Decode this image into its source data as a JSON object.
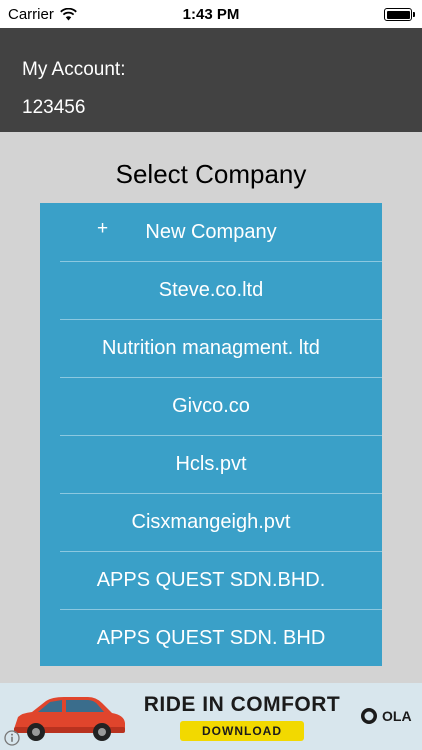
{
  "status_bar": {
    "carrier": "Carrier",
    "time": "1:43 PM"
  },
  "account": {
    "label": "My Account:",
    "number": "123456"
  },
  "title": "Select Company",
  "companies": [
    {
      "label": "New Company",
      "prefix": "+"
    },
    {
      "label": "Steve.co.ltd"
    },
    {
      "label": "Nutrition managment. ltd"
    },
    {
      "label": "Givco.co"
    },
    {
      "label": "Hcls.pvt"
    },
    {
      "label": "Cisxmangeigh.pvt"
    },
    {
      "label": "APPS QUEST SDN.BHD."
    },
    {
      "label": "APPS QUEST SDN. BHD"
    }
  ],
  "ad": {
    "headline": "RIDE IN COMFORT",
    "button": "DOWNLOAD",
    "brand": "OLA"
  },
  "colors": {
    "header_bg": "#424242",
    "list_bg": "#3aa0c8",
    "screen_bg": "#d3d3d3",
    "ad_button": "#f2d900"
  }
}
